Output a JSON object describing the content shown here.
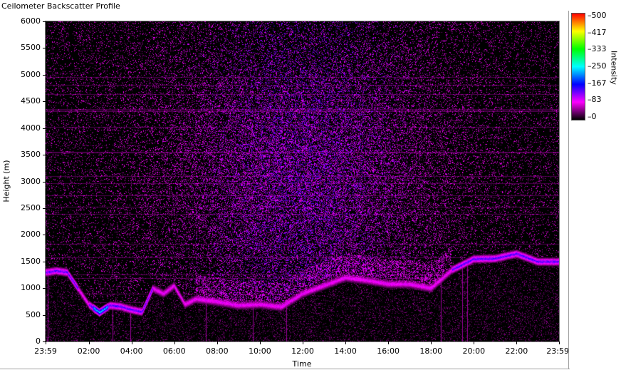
{
  "window": {
    "title": "Ceilometer Backscatter Profile"
  },
  "chart_data": {
    "type": "heatmap",
    "title": "Ceilometer Backscatter Profile",
    "xlabel": "Time",
    "ylabel": "Height (m)",
    "xtick_labels": [
      "23:59",
      "02:00",
      "04:00",
      "06:00",
      "08:00",
      "10:00",
      "12:00",
      "14:00",
      "16:00",
      "18:00",
      "20:00",
      "22:00",
      "23:59"
    ],
    "xtick_hours": [
      0,
      2.0167,
      4.0167,
      6.0167,
      8.0167,
      10.0167,
      12.0167,
      14.0167,
      16.0167,
      18.0167,
      20.0167,
      22.0167,
      24.0
    ],
    "xlim_hours": [
      0,
      24
    ],
    "ytick_labels": [
      "0",
      "500",
      "1000",
      "1500",
      "2000",
      "2500",
      "3000",
      "3500",
      "4000",
      "4500",
      "5000",
      "5500",
      "6000"
    ],
    "ylim": [
      0,
      6000
    ],
    "colorbar": {
      "label": "Intensity",
      "ticks": [
        "500",
        "417",
        "333",
        "250",
        "167",
        "83",
        "0"
      ],
      "range": [
        0,
        500
      ],
      "colors": [
        "#000000",
        "#ff00ff",
        "#0000ff",
        "#00ffff",
        "#00ff00",
        "#ffff00",
        "#ff0000"
      ]
    },
    "layer_boundary_height_m": [
      [
        0.0,
        1300
      ],
      [
        0.5,
        1330
      ],
      [
        1.0,
        1300
      ],
      [
        1.5,
        1000
      ],
      [
        2.0,
        700
      ],
      [
        2.5,
        550
      ],
      [
        3.0,
        680
      ],
      [
        3.5,
        660
      ],
      [
        4.0,
        600
      ],
      [
        4.5,
        560
      ],
      [
        5.0,
        1000
      ],
      [
        5.5,
        900
      ],
      [
        6.0,
        1050
      ],
      [
        6.5,
        700
      ],
      [
        7.0,
        800
      ],
      [
        8.0,
        750
      ],
      [
        9.0,
        680
      ],
      [
        10.0,
        700
      ],
      [
        11.0,
        650
      ],
      [
        12.0,
        900
      ],
      [
        13.0,
        1050
      ],
      [
        14.0,
        1200
      ],
      [
        15.0,
        1150
      ],
      [
        16.0,
        1080
      ],
      [
        17.0,
        1080
      ],
      [
        18.0,
        1000
      ],
      [
        19.0,
        1350
      ],
      [
        20.0,
        1550
      ],
      [
        21.0,
        1560
      ],
      [
        22.0,
        1650
      ],
      [
        23.0,
        1500
      ],
      [
        24.0,
        1500
      ]
    ]
  }
}
